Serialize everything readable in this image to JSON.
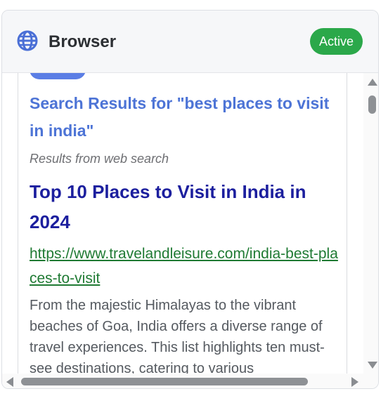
{
  "header": {
    "title": "Browser",
    "status_badge": "Active",
    "icon": "globe-icon"
  },
  "search": {
    "heading": "Search Results for \"best places to visit in india\"",
    "source_note": "Results from web search"
  },
  "results": [
    {
      "title": "Top 10 Places to Visit in India in 2024",
      "url": "https://www.travelandleisure.com/india-best-places-to-visit",
      "snippet": "From the majestic Himalayas to the vibrant beaches of Goa, India offers a diverse range of travel experiences. This list highlights ten must-see destinations, catering to various"
    }
  ],
  "colors": {
    "badge": "#2ba84a",
    "accent": "#4d74d6",
    "result_title": "#1c1f9e",
    "url": "#1f7a33"
  }
}
